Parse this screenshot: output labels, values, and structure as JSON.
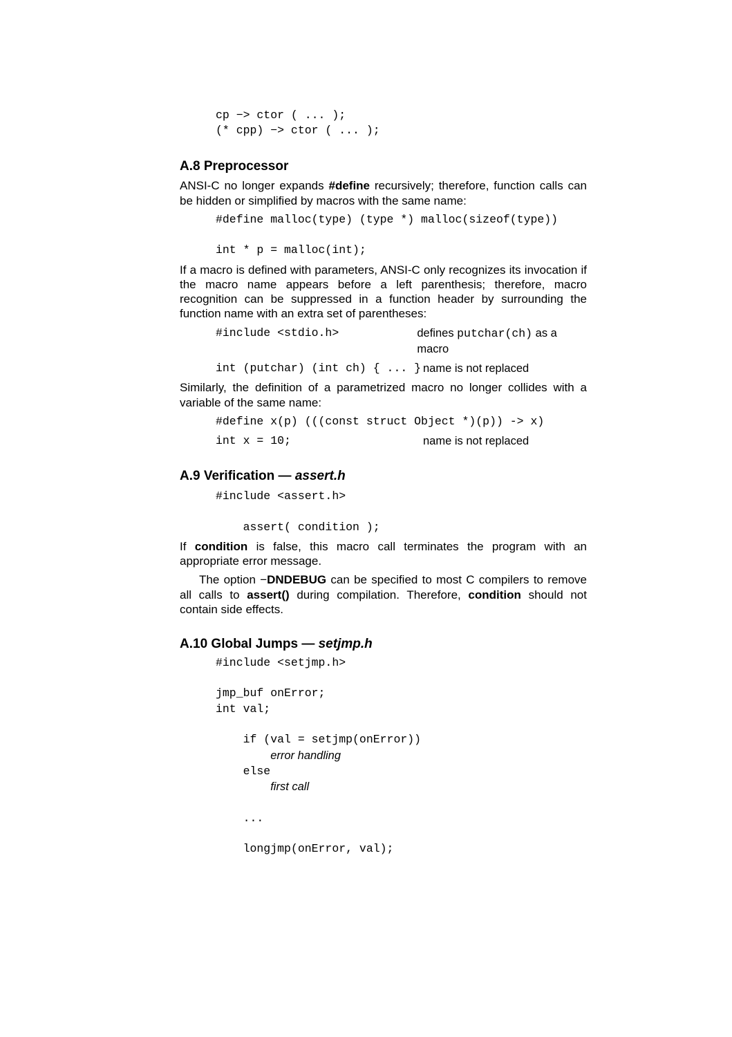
{
  "top_code": "cp −> ctor ( ... );\n(* cpp) −> ctor ( ... );",
  "s8": {
    "heading": "A.8  Preprocessor",
    "p1_a": "ANSI-",
    "p1_b": "C",
    "p1_c": " no longer expands ",
    "p1_d": "#define",
    "p1_e": " recursively; therefore, function calls can be hidden or simplified by macros with the same name:",
    "code1": "#define malloc(type) (type *) malloc(sizeof(type))\n\nint * p = malloc(int);",
    "p2": "If a macro is defined with parameters, ANSI-C only recognizes its invocation if the macro name appears before a left parenthesis; therefore, macro recognition can be suppressed in a function header by surrounding the function name with an extra set of parentheses:",
    "row1_code": "#include <stdio.h>",
    "row1_ann_a": "defines ",
    "row1_ann_b": "putchar(ch)",
    "row1_ann_c": " as a macro",
    "row2_code": "int (putchar) (int ch) { ... }",
    "row2_ann": "name is not replaced",
    "p3": "Similarly, the definition of a parametrized macro no longer collides with a variable of the same name:",
    "code3": "#define x(p) (((const struct Object *)(p)) -> x)",
    "row3_code": "int x = 10;",
    "row3_ann": "name is not replaced"
  },
  "s9": {
    "heading_a": "A.9  Verification — ",
    "heading_b": "assert.h",
    "code": "#include <assert.h>\n\n    assert( condition );",
    "p1_a": "If ",
    "p1_b": "condition",
    "p1_c": " is false, this macro call terminates the program with an appropriate error message.",
    "p2_a": "The option −",
    "p2_b": "DNDEBUG",
    "p2_c": " can be specified to most C compilers to remove all calls to ",
    "p2_d": "assert()",
    "p2_e": " during compilation.  Therefore, ",
    "p2_f": "condition",
    "p2_g": " should not contain side effects."
  },
  "s10": {
    "heading_a": "A.10  Global Jumps — ",
    "heading_b": "setjmp.h",
    "line1": "#include <setjmp.h>",
    "line2": "jmp_buf onError;",
    "line3": "int val;",
    "line4": "    if (val = setjmp(onError))",
    "line5pad": "        ",
    "line5": "error handling",
    "line6": "    else",
    "line7pad": "        ",
    "line7": "first call",
    "line8": "    ...",
    "line9": "    longjmp(onError, val);"
  }
}
